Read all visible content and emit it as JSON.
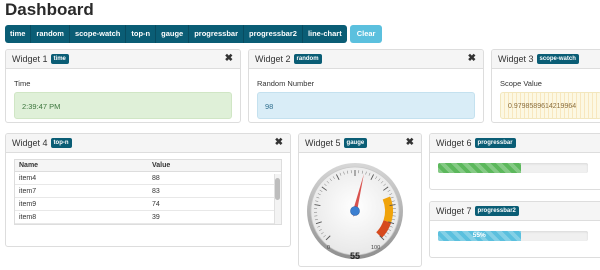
{
  "page": {
    "title": "Dashboard"
  },
  "toolbar": {
    "buttons": [
      "time",
      "random",
      "scope-watch",
      "top-n",
      "gauge",
      "progressbar",
      "progressbar2",
      "line-chart"
    ],
    "clear_label": "Clear"
  },
  "widgets": {
    "w1": {
      "title": "Widget 1",
      "badge": "time",
      "label": "Time",
      "value": "2:39:47 PM"
    },
    "w2": {
      "title": "Widget 2",
      "badge": "random",
      "label": "Random Number",
      "value": "98"
    },
    "w3": {
      "title": "Widget 3",
      "badge": "scope-watch",
      "label": "Scope Value",
      "value": "0.9798589614219964"
    },
    "w4": {
      "title": "Widget 4",
      "badge": "top-n",
      "columns": [
        "Name",
        "Value"
      ],
      "rows": [
        [
          "item4",
          "88"
        ],
        [
          "item7",
          "83"
        ],
        [
          "item9",
          "74"
        ],
        [
          "item8",
          "39"
        ]
      ]
    },
    "w5": {
      "title": "Widget 5",
      "badge": "gauge",
      "value": 55,
      "value_label": "55",
      "min_label": "0",
      "max_label": "100"
    },
    "w6": {
      "title": "Widget 6",
      "badge": "progressbar",
      "progress": 0.55
    },
    "w7": {
      "title": "Widget 7",
      "badge": "progressbar2",
      "progress": 0.55,
      "progress_label": "55%"
    }
  },
  "icons": {
    "close": "close-icon"
  },
  "colors": {
    "badge": "#0a5d75",
    "clear": "#5bc0de",
    "green_bar": "#5cb85c",
    "blue_bar": "#5bc0de",
    "needle": "#d9534f",
    "gauge_warn": "#f0a30a",
    "gauge_danger": "#d64a1e"
  }
}
